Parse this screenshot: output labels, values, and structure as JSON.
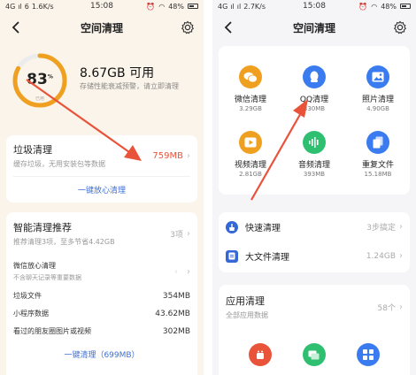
{
  "status": {
    "left": {
      "carrier": "4G",
      "signal": "ıl",
      "carrier2": "6",
      "speed": "1.6K/s"
    },
    "right": {
      "carrier": "4G",
      "signal": "ıl",
      "carrier2": "ıl",
      "speed": "2.7K/s"
    },
    "time": "15:08",
    "battery": "48%"
  },
  "left": {
    "nav": {
      "title": "空间清理",
      "back_icon": "back-arrow-icon",
      "settings_icon": "gear-icon"
    },
    "storage": {
      "percent": "83",
      "percent_sign": "%",
      "ring_sub": "已用",
      "available": "8.67GB 可用",
      "desc": "存储性能衰减预警，请立即清理",
      "ring_color": "#f0a020"
    },
    "junk": {
      "title": "垃圾清理",
      "sub": "缓存垃圾，无用安装包等数据",
      "value": "759MB",
      "action": "一键放心清理"
    },
    "smart": {
      "title": "智能清理推荐",
      "sub": "推荐清理3项，至多节省4.42GB",
      "count": "3项",
      "wechat": {
        "title": "微信放心清理",
        "sub": "不含聊天记录等重要数据"
      },
      "rows": [
        {
          "label": "垃圾文件",
          "value": "354MB"
        },
        {
          "label": "小程序数据",
          "value": "43.62MB"
        },
        {
          "label": "看过的朋友圈图片或视频",
          "value": "302MB"
        }
      ],
      "action": "一键清理（699MB）"
    }
  },
  "right": {
    "nav": {
      "title": "空间清理",
      "back_icon": "back-arrow-icon",
      "settings_icon": "gear-icon"
    },
    "grid": [
      {
        "label": "微信清理",
        "size": "3.29GB",
        "icon": "wechat-icon",
        "color": "#f0a020"
      },
      {
        "label": "QQ清理",
        "size": "330MB",
        "icon": "qq-icon",
        "color": "#3a7bf0"
      },
      {
        "label": "照片清理",
        "size": "4.90GB",
        "icon": "photo-icon",
        "color": "#3a7bf0"
      },
      {
        "label": "视频清理",
        "size": "2.81GB",
        "icon": "video-icon",
        "color": "#f0a020"
      },
      {
        "label": "音频清理",
        "size": "393MB",
        "icon": "audio-icon",
        "color": "#2fbf71"
      },
      {
        "label": "重复文件",
        "size": "15.18MB",
        "icon": "duplicate-file-icon",
        "color": "#3a7bf0"
      }
    ],
    "list": [
      {
        "label": "快速清理",
        "value": "3步搞定",
        "icon": "broom-icon"
      },
      {
        "label": "大文件清理",
        "value": "1.24GB",
        "icon": "file-icon"
      }
    ],
    "apps": {
      "title": "应用清理",
      "sub": "全部应用数据",
      "count": "58个"
    },
    "accent": "#e8533a"
  }
}
